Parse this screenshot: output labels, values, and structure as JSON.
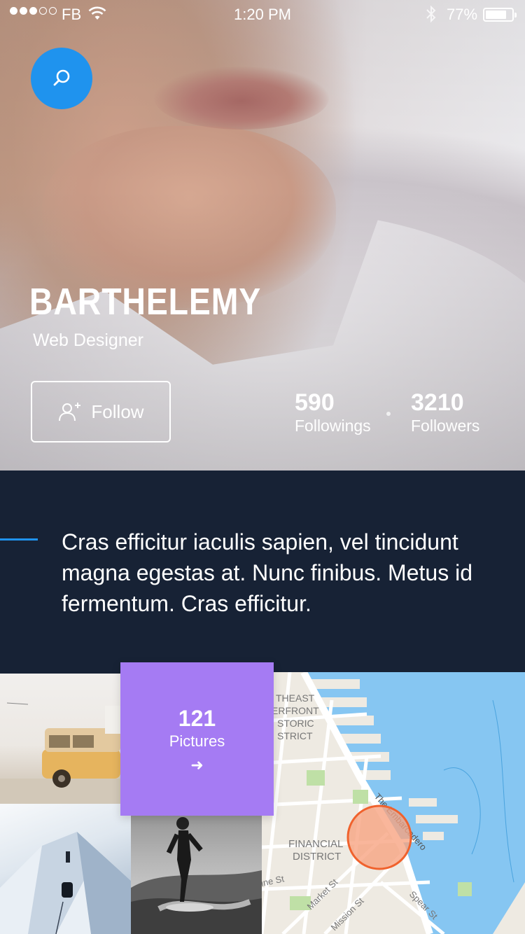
{
  "status_bar": {
    "carrier": "FB",
    "time": "1:20 PM",
    "battery_percent": "77%",
    "signal_filled": 3,
    "signal_total": 5,
    "battery_level": 0.77
  },
  "profile": {
    "name": "BARTHELEMY",
    "role": "Web Designer",
    "follow_label": "Follow",
    "stats": [
      {
        "value": "590",
        "label": "Followings"
      },
      {
        "value": "3210",
        "label": "Followers"
      }
    ]
  },
  "bio": {
    "text": "Cras efficitur iaculis sapien, vel tincidunt magna egestas at. Nunc finibus. Metus id fermentum. Cras efficitur."
  },
  "gallery": {
    "count": "121",
    "label": "Pictures",
    "arrow": "➜"
  },
  "map": {
    "labels": [
      "THEAST",
      "ERFRONT",
      "STORIC",
      "STRICT",
      "The Embarcadero",
      "FINANCIAL",
      "DISTRICT",
      "ine St",
      "Market St",
      "Mission St",
      "Spear St"
    ]
  },
  "icons": {
    "search": "search-icon",
    "follow": "add-user-icon",
    "wifi": "wifi-icon",
    "bluetooth": "bluetooth-icon",
    "battery": "battery-icon",
    "location": "location-marker-icon"
  },
  "colors": {
    "accent_blue": "#1f93ee",
    "dark_navy": "#172235",
    "purple": "#a57bf3",
    "marker_orange": "#f0622d",
    "water": "#86c6f2"
  }
}
